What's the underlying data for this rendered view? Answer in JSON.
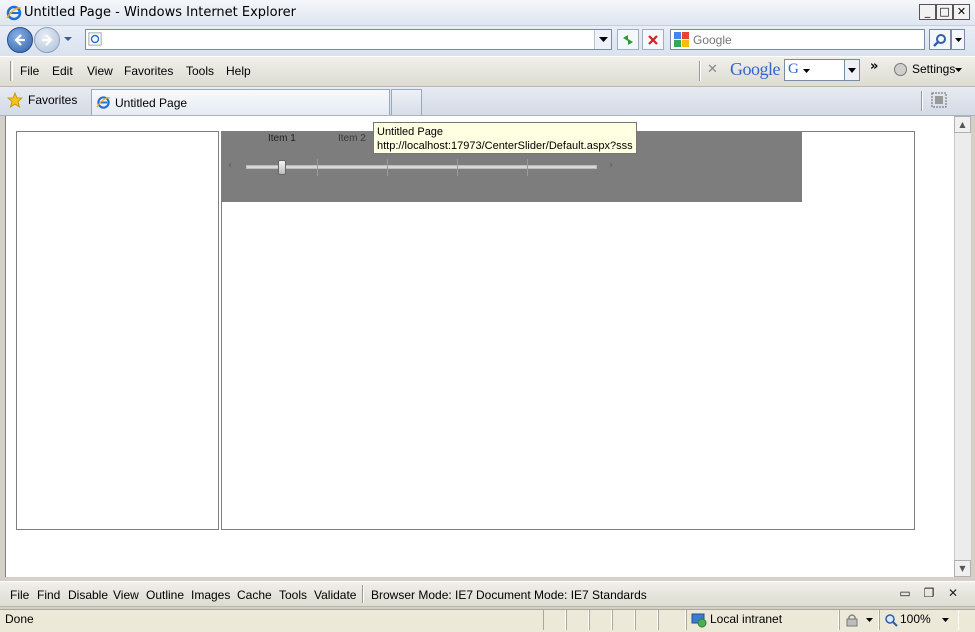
{
  "window": {
    "title": "Untitled Page - Windows Internet Explorer",
    "minimize": "_",
    "maximize": "□",
    "close": "✕"
  },
  "address_bar": {
    "url": "",
    "search_placeholder": "Google"
  },
  "menu": {
    "items": [
      {
        "label": "File",
        "accel": "F"
      },
      {
        "label": "Edit",
        "accel": "E"
      },
      {
        "label": "View",
        "accel": "V"
      },
      {
        "label": "Favorites",
        "accel": "a"
      },
      {
        "label": "Tools",
        "accel": "T"
      },
      {
        "label": "Help",
        "accel": "H"
      }
    ]
  },
  "google_toolbar": {
    "close": "✕",
    "logo": "Google",
    "chevron": "»",
    "settings": "Settings"
  },
  "favorites_bar": {
    "favorites_label": "Favorites",
    "tab_title": "Untitled Page"
  },
  "page": {
    "slider": {
      "items": [
        "Item 1",
        "Item 2"
      ],
      "left_arrow": "‹",
      "right_arrow": "›",
      "value": 0.1
    },
    "tooltip": {
      "title": "Untitled Page",
      "url": "http://localhost:17973/CenterSlider/Default.aspx?sss"
    }
  },
  "dev_toolbar": {
    "items": [
      "File",
      "Find",
      "Disable",
      "View",
      "Outline",
      "Images",
      "Cache",
      "Tools",
      "Validate"
    ],
    "browser_mode": "Browser Mode:  IE7",
    "document_mode": "Document Mode:  IE7 Standards"
  },
  "status_bar": {
    "status": "Done",
    "zone": "Local intranet",
    "zoom": "100%"
  },
  "colors": {
    "slider_background": "#7d7d7d",
    "tooltip_background": "#ffffe1",
    "nav_button": "#2f5fa8"
  }
}
